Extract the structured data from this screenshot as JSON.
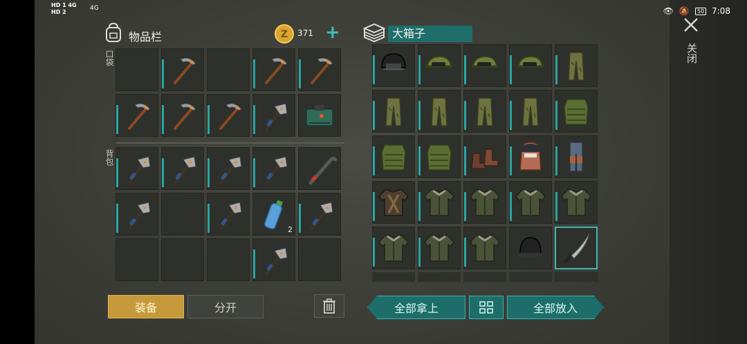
{
  "status_bar": {
    "left_top": "HD 1  4G",
    "left_bottom": "HD 2",
    "signal2": "4G",
    "battery": "50",
    "time": "7:08"
  },
  "inventory": {
    "title": "物品栏",
    "coins": "371",
    "add_symbol": "+",
    "pocket_label": "口袋",
    "backpack_label": "背包",
    "pocket_slots": [
      {
        "item": "empty"
      },
      {
        "item": "pickaxe"
      },
      {
        "item": "empty"
      },
      {
        "item": "pickaxe"
      },
      {
        "item": "pickaxe"
      },
      {
        "item": "pickaxe"
      },
      {
        "item": "pickaxe"
      },
      {
        "item": "pickaxe"
      },
      {
        "item": "hatchet"
      },
      {
        "item": "tackle-box"
      }
    ],
    "backpack_slots": [
      {
        "item": "hatchet"
      },
      {
        "item": "hatchet"
      },
      {
        "item": "hatchet"
      },
      {
        "item": "hatchet"
      },
      {
        "item": "crowbar"
      },
      {
        "item": "hatchet"
      },
      {
        "item": "empty"
      },
      {
        "item": "hatchet"
      },
      {
        "item": "water-bottle",
        "qty": "2"
      },
      {
        "item": "hatchet"
      },
      {
        "item": "empty"
      },
      {
        "item": "empty"
      },
      {
        "item": "empty"
      },
      {
        "item": "hatchet"
      },
      {
        "item": "empty"
      }
    ],
    "equip_button": "装备",
    "split_button": "分开"
  },
  "chest": {
    "title": "大箱子",
    "slots": [
      {
        "item": "helmet"
      },
      {
        "item": "camo-cap"
      },
      {
        "item": "camo-cap"
      },
      {
        "item": "camo-cap"
      },
      {
        "item": "camo-pants"
      },
      {
        "item": "camo-pants"
      },
      {
        "item": "camo-pants"
      },
      {
        "item": "camo-pants"
      },
      {
        "item": "camo-pants"
      },
      {
        "item": "camo-vest"
      },
      {
        "item": "camo-vest"
      },
      {
        "item": "camo-vest"
      },
      {
        "item": "boots"
      },
      {
        "item": "balaclava"
      },
      {
        "item": "leg-armor"
      },
      {
        "item": "armored-jacket"
      },
      {
        "item": "jacket"
      },
      {
        "item": "jacket"
      },
      {
        "item": "jacket"
      },
      {
        "item": "jacket"
      },
      {
        "item": "jacket"
      },
      {
        "item": "jacket"
      },
      {
        "item": "jacket"
      },
      {
        "item": "beanie"
      },
      {
        "item": "machete"
      }
    ],
    "take_all_button": "全部拿上",
    "sort_icon": "grid-sort-icon",
    "put_all_button": "全部放入"
  },
  "close": {
    "label": "关闭",
    "icon": "close-icon"
  },
  "colors": {
    "accent_teal": "#2aa6a3",
    "equip_gold": "#c69a3a",
    "bg": "#3d3e38"
  }
}
